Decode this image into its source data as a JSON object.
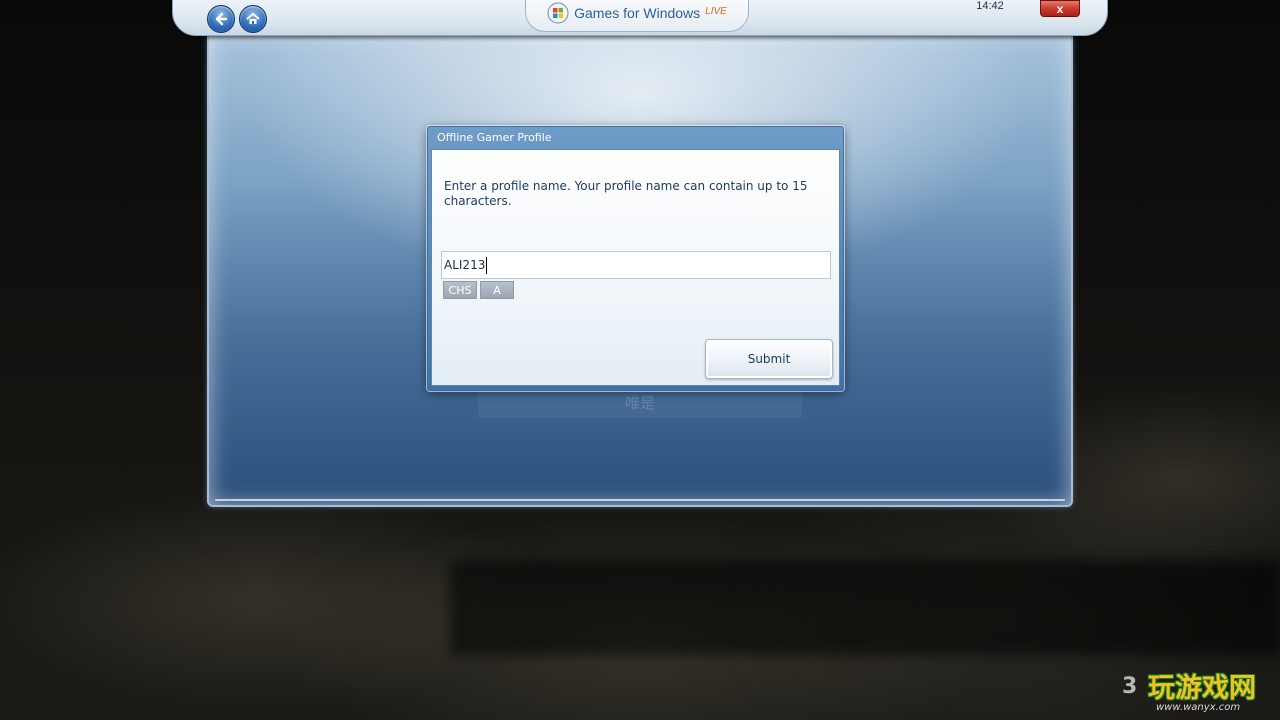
{
  "header": {
    "logo_text": "Games for Windows",
    "logo_live": "LIVE",
    "clock": "14:42",
    "close_label": "x",
    "back_icon": "back-arrow-icon",
    "home_icon": "home-icon"
  },
  "dialog": {
    "title": "Offline Gamer Profile",
    "instructions": "Enter a profile name. Your profile name can contain up to 15 characters.",
    "input_value": "ALI213",
    "ime_language": "CHS",
    "ime_mode": "A",
    "submit_label": "Submit"
  },
  "background": {
    "ghost_button_text": "唯是"
  },
  "watermark": {
    "text": "玩游戏网",
    "url": "www.wanyx.com",
    "prefix": "3"
  },
  "colors": {
    "accent_blue": "#2e6cb8",
    "close_red": "#c7372a",
    "live_orange": "#e3671e"
  }
}
